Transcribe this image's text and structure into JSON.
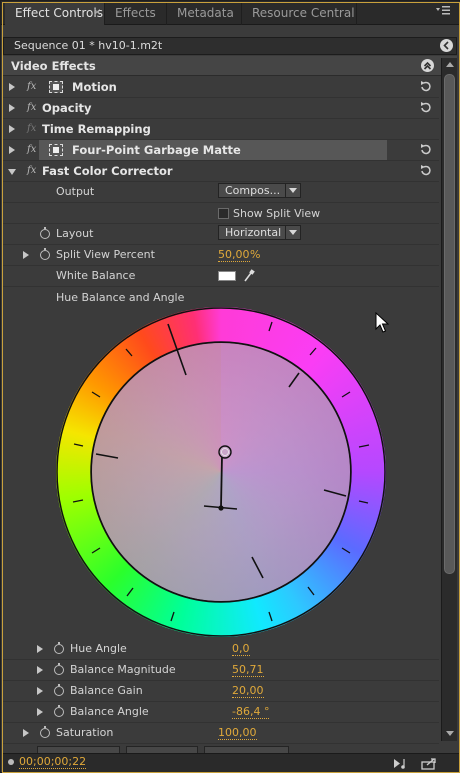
{
  "tabs": [
    {
      "label": "Effect Controls",
      "active": true
    },
    {
      "label": "Effects",
      "active": false
    },
    {
      "label": "Metadata",
      "active": false
    },
    {
      "label": "Resource Central",
      "active": false
    }
  ],
  "tab_close_glyph": "×",
  "panel_menu_icon": "panel-menu-icon",
  "sequence_title": "Sequence 01 * hv10-1.m2t",
  "section_title": "Video Effects",
  "effects": [
    {
      "name": "Motion",
      "fx": "fx",
      "icon": "transform-icon"
    },
    {
      "name": "Opacity",
      "fx": "fx"
    },
    {
      "name": "Time Remapping",
      "fx": "fx"
    },
    {
      "name": "Four-Point Garbage Matte",
      "fx": "fx",
      "icon": "mask-icon"
    },
    {
      "name": "Fast Color Corrector",
      "fx": "fx",
      "expanded": true
    }
  ],
  "fcc": {
    "output_label": "Output",
    "output_value": "Compos...",
    "show_split_label": "Show Split View",
    "layout_label": "Layout",
    "layout_value": "Horizontal",
    "split_percent_label": "Split View Percent",
    "split_percent_value": "50,00",
    "split_percent_unit": "%",
    "white_balance_label": "White Balance",
    "white_balance_color": "#ffffff",
    "hue_wheel_label": "Hue Balance and Angle",
    "hue_angle_label": "Hue Angle",
    "hue_angle_value": "0,0",
    "balance_mag_label": "Balance Magnitude",
    "balance_mag_value": "50,71",
    "balance_gain_label": "Balance Gain",
    "balance_gain_value": "20,00",
    "balance_angle_label": "Balance Angle",
    "balance_angle_value": "-86,4 °",
    "saturation_label": "Saturation",
    "saturation_value": "100,00"
  },
  "timecode": "00;00;00;22",
  "colors": {
    "accent": "#e0a93a",
    "panel_bg": "#3b3b3b",
    "frame": "#c9a13c"
  }
}
